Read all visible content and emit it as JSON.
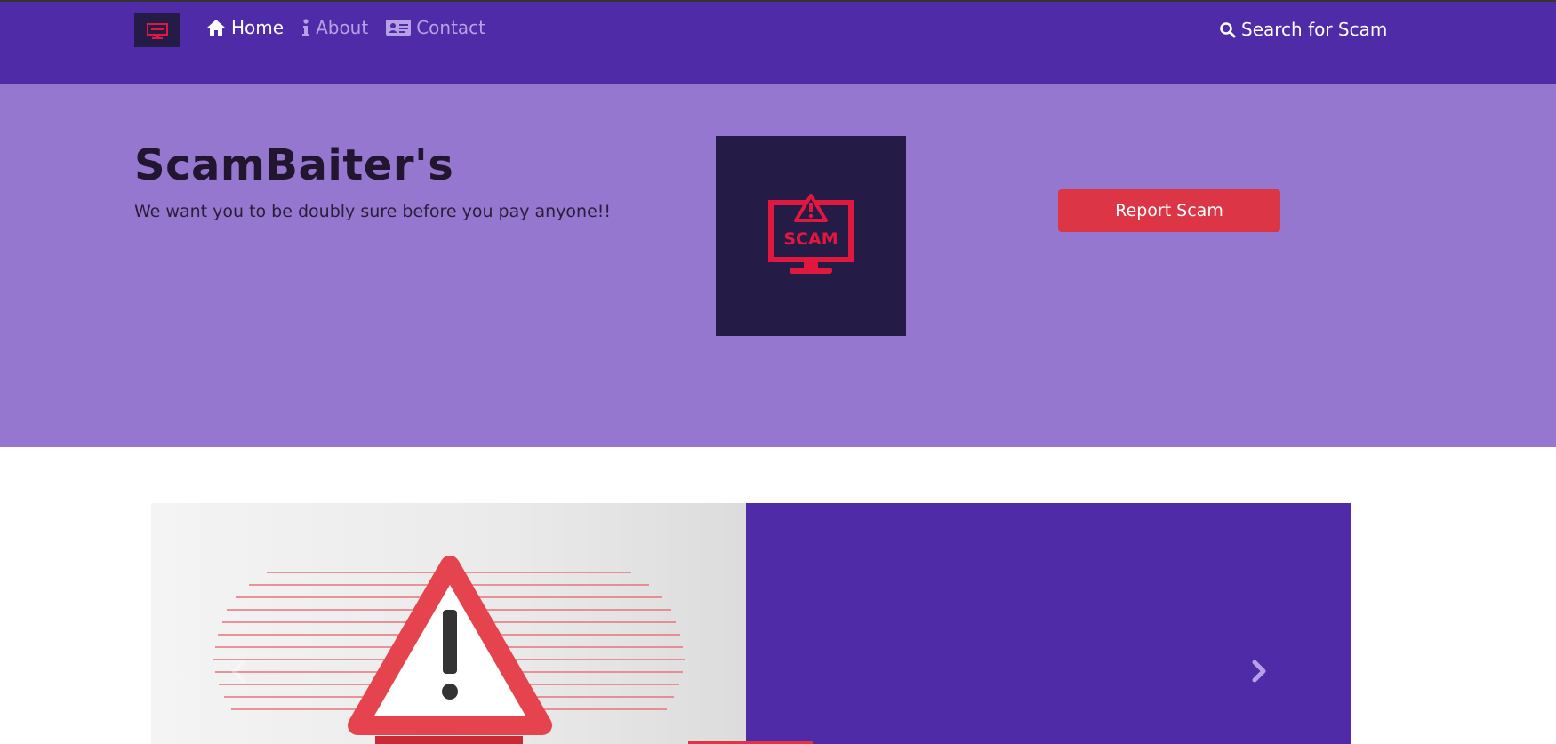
{
  "navbar": {
    "brand_icon": "scam-monitor-icon",
    "links": [
      {
        "label": "Home",
        "icon": "home-icon",
        "active": true
      },
      {
        "label": "About",
        "icon": "info-icon",
        "active": false
      },
      {
        "label": "Contact",
        "icon": "contact-card-icon",
        "active": false
      }
    ],
    "search": {
      "label": "Search for Scam",
      "icon": "search-icon"
    }
  },
  "hero": {
    "title": "ScamBaiter's",
    "subtitle": "We want you to be doubly sure before you pay anyone!!",
    "logo_text": "SCAM",
    "report_button": "Report Scam"
  },
  "carousel": {
    "image_icon": "warning-triangle-icon",
    "prev_icon": "chevron-left-icon",
    "next_icon": "chevron-right-icon"
  },
  "colors": {
    "navbar": "#4f2ba7",
    "hero": "#9677cf",
    "accent_red": "#dc3545",
    "logo_bg": "#241c47"
  }
}
